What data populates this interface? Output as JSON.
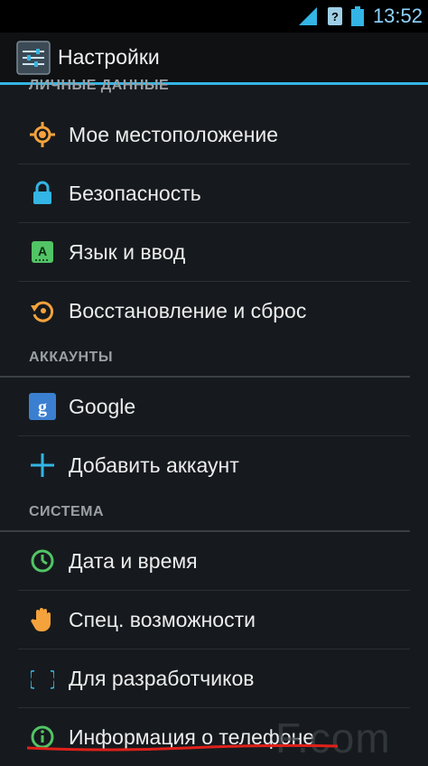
{
  "status_bar": {
    "time": "13:52",
    "icons": [
      "signal-icon",
      "no-sim-icon",
      "battery-icon"
    ]
  },
  "action_bar": {
    "title": "Настройки",
    "icon": "settings-sliders-icon"
  },
  "cut_header": "ЛИЧНЫЕ ДАННЫЕ",
  "personal": [
    {
      "label": "Мое местоположение",
      "icon": "location-icon"
    },
    {
      "label": "Безопасность",
      "icon": "lock-icon"
    },
    {
      "label": "Язык и ввод",
      "icon": "keyboard-language-icon"
    },
    {
      "label": "Восстановление и сброс",
      "icon": "backup-reset-icon"
    }
  ],
  "accounts_header": "АККАУНТЫ",
  "accounts": [
    {
      "label": "Google",
      "icon": "google-icon"
    },
    {
      "label": "Добавить аккаунт",
      "icon": "plus-icon"
    }
  ],
  "system_header": "СИСТЕМА",
  "system": [
    {
      "label": "Дата и время",
      "icon": "clock-icon"
    },
    {
      "label": "Спец. возможности",
      "icon": "hand-icon"
    },
    {
      "label": "Для разработчиков",
      "icon": "braces-icon"
    },
    {
      "label": "Информация о телефоне",
      "icon": "info-icon"
    }
  ],
  "watermark": "F.com",
  "colors": {
    "accent": "#33b5e5",
    "background": "#161a1e"
  }
}
